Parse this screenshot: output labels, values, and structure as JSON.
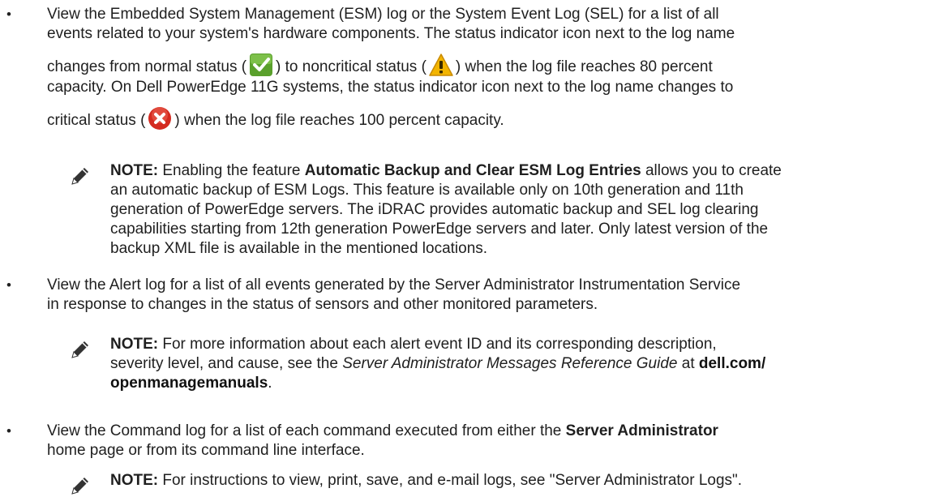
{
  "bullets": [
    {
      "lines": [
        "View the Embedded System Management (ESM) log or the System Event Log (SEL) for a list of all",
        "events related to your system's hardware components. The status indicator icon next to the log name"
      ],
      "line3_pre": "changes from normal status (",
      "line3_mid": ") to noncritical status (",
      "line3_post": ") when the log file reaches 80 percent",
      "line4": "capacity. On Dell PowerEdge 11G systems, the status indicator icon next to the log name changes to",
      "line5_pre": "critical status (",
      "line5_post": ") when the log file reaches 100 percent capacity."
    },
    {
      "lines": [
        "View the Alert log for a list of all events generated by the Server Administrator Instrumentation Service",
        "in response to changes in the status of sensors and other monitored parameters."
      ]
    },
    {
      "line1_pre": "View the Command log for a list of each command executed from either the ",
      "line1_bold": "Server Administrator",
      "line2": "home page or from its command line interface."
    }
  ],
  "note1": {
    "label": "NOTE:",
    "l1_pre": " Enabling the feature ",
    "l1_bold": "Automatic Backup and Clear ESM Log Entries",
    "l1_post": " allows you to create",
    "l2": "an automatic backup of ESM Logs. This feature is available only on 10th generation and 11th",
    "l3": "generation of PowerEdge servers. The iDRAC provides automatic backup and SEL log clearing",
    "l4": "capabilities starting from 12th generation PowerEdge servers and later. Only latest version of the",
    "l5": "backup XML file is available in the mentioned locations."
  },
  "note2": {
    "label": "NOTE:",
    "l1": " For more information about each alert event ID and its corresponding description,",
    "l2_pre": "severity level, and cause, see the ",
    "l2_italic": "Server Administrator Messages Reference Guide",
    "l2_mid": " at ",
    "l2_link": "dell.com/",
    "l3_link": "openmanagemanuals",
    "l3_post": "."
  },
  "note3": {
    "label": "NOTE:",
    "text": " For instructions to view, print, save, and e-mail logs, see \"Server Administrator Logs\"."
  },
  "icons": {
    "bullet": "bullet-dot",
    "note": "pencil-note-icon",
    "normal": "normal-status-icon",
    "noncritical": "noncritical-status-icon",
    "critical": "critical-status-icon"
  },
  "colors": {
    "normal_status": "#5aa02c",
    "noncritical_status": "#f2b400",
    "critical_status": "#d42a1f"
  }
}
